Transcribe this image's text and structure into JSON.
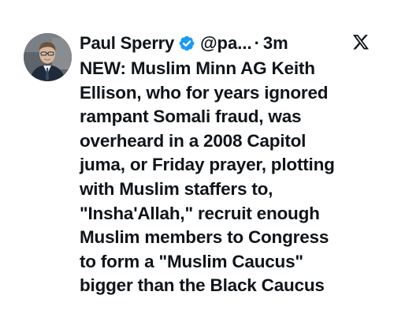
{
  "author": {
    "display_name": "Paul Sperry",
    "handle": "@pa...",
    "separator": "·",
    "timestamp": "3m",
    "verified": true
  },
  "tweet": {
    "lines": [
      "NEW: Muslim Minn AG Keith",
      "Ellison, who for years ignored",
      "rampant Somali fraud, was",
      "overheard in a 2008 Capitol",
      "juma, or Friday prayer, plotting",
      "with Muslim staffers to,",
      "\"Insha'Allah,\" recruit enough",
      "Muslim members to Congress",
      "to form a \"Muslim Caucus\"",
      "bigger than the Black Caucus"
    ]
  },
  "icons": {
    "verified": "verified-badge-icon",
    "platform": "x-logo-icon"
  },
  "colors": {
    "text": "#0f1419",
    "verified_badge": "#1d9bf0",
    "background": "#ffffff"
  }
}
